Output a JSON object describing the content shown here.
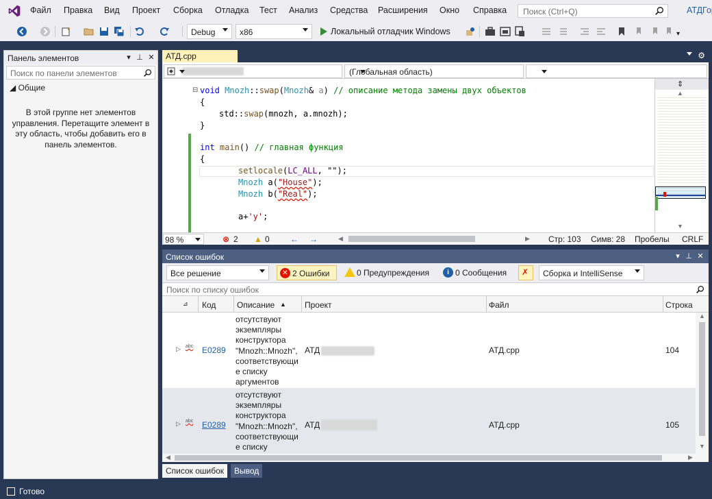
{
  "menu": {
    "items": [
      "Файл",
      "Правка",
      "Вид",
      "Проект",
      "Сборка",
      "Отладка",
      "Тест",
      "Анализ",
      "Средства",
      "Расширения",
      "Окно",
      "Справка"
    ],
    "search_placeholder": "Поиск (Ctrl+Q)",
    "app_title": "АТДГор"
  },
  "toolbar": {
    "config": "Debug",
    "platform": "x86",
    "debugger_label": "Локальный отладчик Windows"
  },
  "toolbox": {
    "title": "Панель элементов",
    "search_placeholder": "Поиск по панели элементов",
    "group": "◢ Общие",
    "empty_message": "В этой группе нет элементов управления. Перетащите элемент в эту область, чтобы добавить его в панель элементов."
  },
  "editor": {
    "tab_name": "АТД.cpp",
    "scope": "(Глобальная область)",
    "code": {
      "line1_rest": "(Mnozh& a) // описание метода замены двух объектов",
      "line3": "std::swap(mnozh, a.mnozh);",
      "main_sig": "int main() // главная функция",
      "setlocale": "setlocale(LC_ALL, \"\");",
      "mnozh_a": "Mnozh a(\"House\");",
      "mnozh_b": "Mnozh b(\"Real\");",
      "add": "a+'y';"
    },
    "status": {
      "zoom": "98 %",
      "errors": "2",
      "warnings": "0",
      "line": "Стр: 103",
      "col": "Симв: 28",
      "spaces": "Пробелы",
      "eol": "CRLF"
    }
  },
  "error_list": {
    "title": "Список ошибок",
    "scope": "Все решение",
    "errors_btn": "2 Ошибки",
    "warnings_btn": "0 Предупреждения",
    "messages_btn": "0 Сообщения",
    "build_filter": "Сборка и IntelliSense",
    "search_placeholder": "Поиск по списку ошибок",
    "columns": {
      "code": "Код",
      "description": "Описание",
      "project": "Проект",
      "file": "Файл",
      "line": "Строка"
    },
    "rows": [
      {
        "code": "E0289",
        "description": "отсутствуют экземпляры конструктора \"Mnozh::Mnozh\", соответствующи е списку аргументов",
        "project": "АТД",
        "file": "АТД.cpp",
        "line": "104"
      },
      {
        "code": "E0289",
        "description": "отсутствуют экземпляры конструктора \"Mnozh::Mnozh\", соответствующи е списку",
        "project": "АТД",
        "file": "АТД.cpp",
        "line": "105"
      }
    ],
    "bottom_tabs": [
      "Список ошибок",
      "Вывод"
    ]
  },
  "statusbar": {
    "text": "Готово"
  },
  "colors": {
    "accent": "#007acc",
    "chrome": "#293955",
    "error": "#e51400"
  }
}
